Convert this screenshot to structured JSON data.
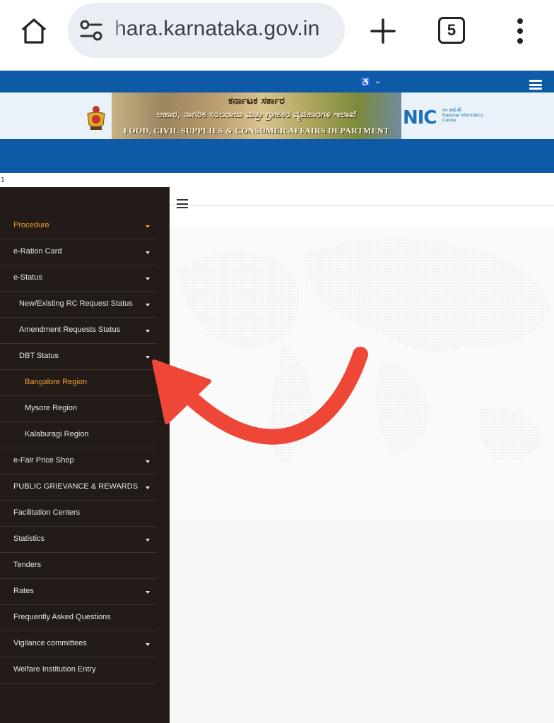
{
  "browser": {
    "url": "hara.karnataka.gov.in",
    "tab_count": "5"
  },
  "site": {
    "banner_title": "ಕರ್ನಾಟಕ ಸರ್ಕಾರ",
    "banner_subtitle": "ಆಹಾರ, ನಾಗರಿಕ ಸರಬರಾಜು ಮತ್ತು ಗ್ರಾಹಕರ ವ್ಯವಹಾರಗಳ ಇಲಾಖೆ",
    "banner_department": "FOOD, CIVIL SUPPLIES & CONSUMER AFFAIRS DEPARTMENT",
    "nic_logo": "NIC",
    "nic_hindi": "एन आई सी",
    "nic_text": "National Informatics Centre",
    "page_marker": "1"
  },
  "sidebar": {
    "items": [
      {
        "label": "Procedure",
        "indent": 0,
        "has_caret": true,
        "active": true
      },
      {
        "label": "e-Ration Card",
        "indent": 0,
        "has_caret": true,
        "active": false
      },
      {
        "label": "e-Status",
        "indent": 0,
        "has_caret": true,
        "active": false
      },
      {
        "label": "New/Existing RC Request Status",
        "indent": 1,
        "has_caret": true,
        "active": false
      },
      {
        "label": "Amendment Requests Status",
        "indent": 1,
        "has_caret": true,
        "active": false
      },
      {
        "label": "DBT Status",
        "indent": 1,
        "has_caret": true,
        "active": false
      },
      {
        "label": "Bangalore Region",
        "indent": 2,
        "has_caret": false,
        "active": true
      },
      {
        "label": "Mysore Region",
        "indent": 2,
        "has_caret": false,
        "active": false
      },
      {
        "label": "Kalaburagi Region",
        "indent": 2,
        "has_caret": false,
        "active": false
      },
      {
        "label": "e-Fair Price Shop",
        "indent": 0,
        "has_caret": true,
        "active": false
      },
      {
        "label": "PUBLIC GRIEVANCE & REWARDS",
        "indent": 0,
        "has_caret": true,
        "active": false
      },
      {
        "label": "Facilitation Centers",
        "indent": 0,
        "has_caret": false,
        "active": false
      },
      {
        "label": "Statistics",
        "indent": 0,
        "has_caret": true,
        "active": false
      },
      {
        "label": "Tenders",
        "indent": 0,
        "has_caret": false,
        "active": false
      },
      {
        "label": "Rates",
        "indent": 0,
        "has_caret": true,
        "active": false
      },
      {
        "label": "Frequently Asked Questions",
        "indent": 0,
        "has_caret": false,
        "active": false
      },
      {
        "label": "Vigilance committees",
        "indent": 0,
        "has_caret": true,
        "active": false
      },
      {
        "label": "Welfare Institution Entry",
        "indent": 0,
        "has_caret": false,
        "active": false
      }
    ]
  },
  "colors": {
    "header_blue": "#0f5aa6",
    "sidebar_bg": "#221b17",
    "active_orange": "#f0a030",
    "annotation_arrow": "#ee4637"
  }
}
